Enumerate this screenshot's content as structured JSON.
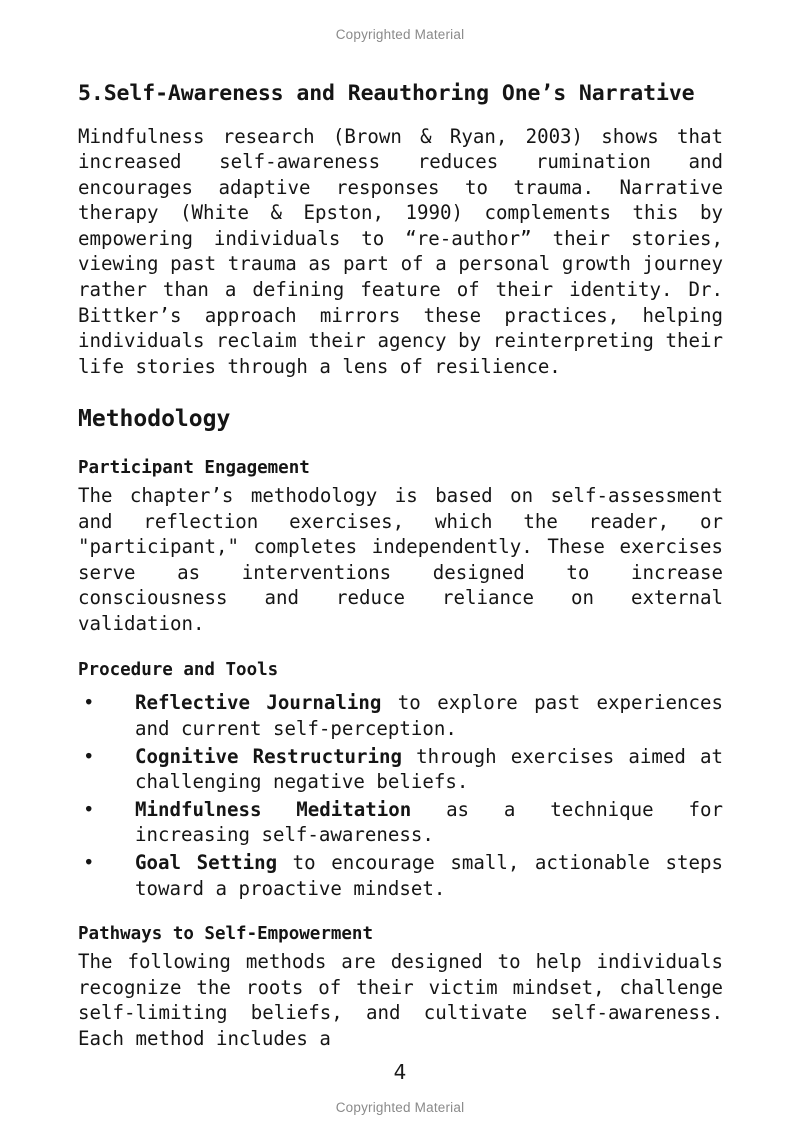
{
  "page": {
    "header_mark": "Copyrighted Material",
    "footer_mark": "Copyrighted Material",
    "page_number": "4",
    "background_color": "#ffffff",
    "text_color": "#151515",
    "mark_color": "#8a8a8a"
  },
  "content": {
    "numbered_heading": "5.Self-Awareness and Reauthoring One’s Narrative",
    "intro_paragraph": "Mindfulness research (Brown & Ryan, 2003) shows that increased self-awareness reduces rumination and encourages adaptive responses to trauma. Narrative therapy (White & Epston, 1990) complements this by empowering individuals to “re-author” their stories, viewing past trauma as part of a personal growth journey rather than a defining feature of their identity. Dr. Bittker’s approach mirrors these practices, helping individuals reclaim their agency by reinterpreting their life stories through a lens of resilience.",
    "methodology_heading": "Methodology",
    "participant_engagement": {
      "heading": "Participant Engagement",
      "paragraph": "The chapter’s methodology is based on self-assessment and reflection exercises, which the reader, or \"participant,\" completes independently. These exercises serve as interventions designed to increase consciousness and reduce reliance on external validation."
    },
    "procedure_and_tools": {
      "heading": "Procedure and Tools",
      "bullet_marker": "•",
      "items": [
        {
          "term": "Reflective Journaling",
          "rest": " to explore past experiences and current self-perception."
        },
        {
          "term": "Cognitive Restructuring",
          "rest": " through exercises aimed at challenging negative beliefs."
        },
        {
          "term": "Mindfulness Meditation",
          "rest": " as a technique for increasing self-awareness."
        },
        {
          "term": "Goal Setting",
          "rest": " to encourage small, actionable steps toward a proactive mindset."
        }
      ]
    },
    "pathways": {
      "heading": "Pathways to Self-Empowerment",
      "paragraph": "The following methods are designed to help individuals recognize the roots of their victim mindset, challenge self-limiting beliefs, and cultivate self-awareness. Each method includes a"
    }
  }
}
